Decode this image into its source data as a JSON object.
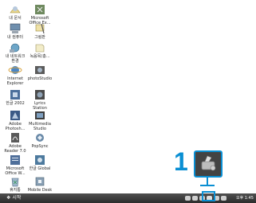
{
  "desktop_icons": [
    {
      "label": "내 문서",
      "icon": "my-documents-icon"
    },
    {
      "label": "Microsoft\nOffice Ex...",
      "icon": "office-excel-icon"
    },
    {
      "label": "내 컴퓨터",
      "icon": "my-computer-icon"
    },
    {
      "label": "그림판",
      "icon": "paint-icon"
    },
    {
      "label": "내 네트워크\n환경",
      "icon": "network-places-icon"
    },
    {
      "label": "녹음목(총...",
      "icon": "recorder-icon"
    },
    {
      "label": "Internet\nExplorer",
      "icon": "internet-explorer-icon"
    },
    {
      "label": "photoStudio",
      "icon": "photo-studio-icon"
    },
    {
      "label": "한글 2002",
      "icon": "hangul-2002-icon"
    },
    {
      "label": "Lyrics\nStation",
      "icon": "lyrics-station-icon"
    },
    {
      "label": "Adobe\nPhotosh...",
      "icon": "adobe-photoshop-icon"
    },
    {
      "label": "Multimedia\nStudio",
      "icon": "multimedia-studio-icon"
    },
    {
      "label": "Adobe\nReader 7.0",
      "icon": "adobe-reader-icon"
    },
    {
      "label": "PopSync",
      "icon": "popsync-icon"
    },
    {
      "label": "Microsoft\nOffice W...",
      "icon": "office-word-icon"
    },
    {
      "label": "한글 Global",
      "icon": "hangul-global-icon"
    },
    {
      "label": "휴지통",
      "icon": "recycle-bin-icon"
    },
    {
      "label": "Mobile Desk",
      "icon": "mobile-desk-icon"
    }
  ],
  "taskbar": {
    "start_label": "시작",
    "clock": "오후 1:45",
    "tray_icons": [
      "tray-icon-1",
      "tray-icon-2",
      "tray-icon-3",
      "tray-icon-4",
      "tray-icon-5",
      "tray-icon-6"
    ]
  },
  "callout": {
    "step_number": "1",
    "zoomed_icon": "tray-app-icon"
  },
  "colors": {
    "accent": "#0a8fd3",
    "taskbar": "#3a3a3a",
    "desktop": "#ffffff"
  }
}
